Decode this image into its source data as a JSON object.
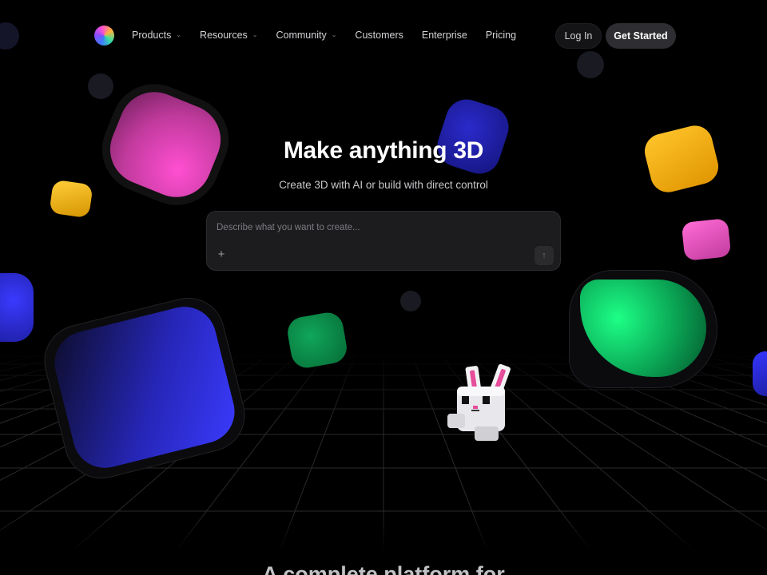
{
  "nav": {
    "items": [
      {
        "label": "Products",
        "has_dropdown": true
      },
      {
        "label": "Resources",
        "has_dropdown": true
      },
      {
        "label": "Community",
        "has_dropdown": true
      },
      {
        "label": "Customers",
        "has_dropdown": false
      },
      {
        "label": "Enterprise",
        "has_dropdown": false
      },
      {
        "label": "Pricing",
        "has_dropdown": false
      }
    ],
    "login_label": "Log In",
    "get_started_label": "Get Started",
    "chevron_icon": "⌄"
  },
  "hero": {
    "title": "Make anything 3D",
    "subtitle": "Create 3D with AI or build with direct control"
  },
  "prompt": {
    "placeholder": "Describe what you want to create...",
    "add_icon": "+",
    "send_icon": "↑"
  },
  "next_section": {
    "heading": "A complete platform for"
  },
  "colors": {
    "background": "#000000",
    "get_started_bg": "#2e2e32",
    "prompt_bg": "#1c1c1e"
  }
}
